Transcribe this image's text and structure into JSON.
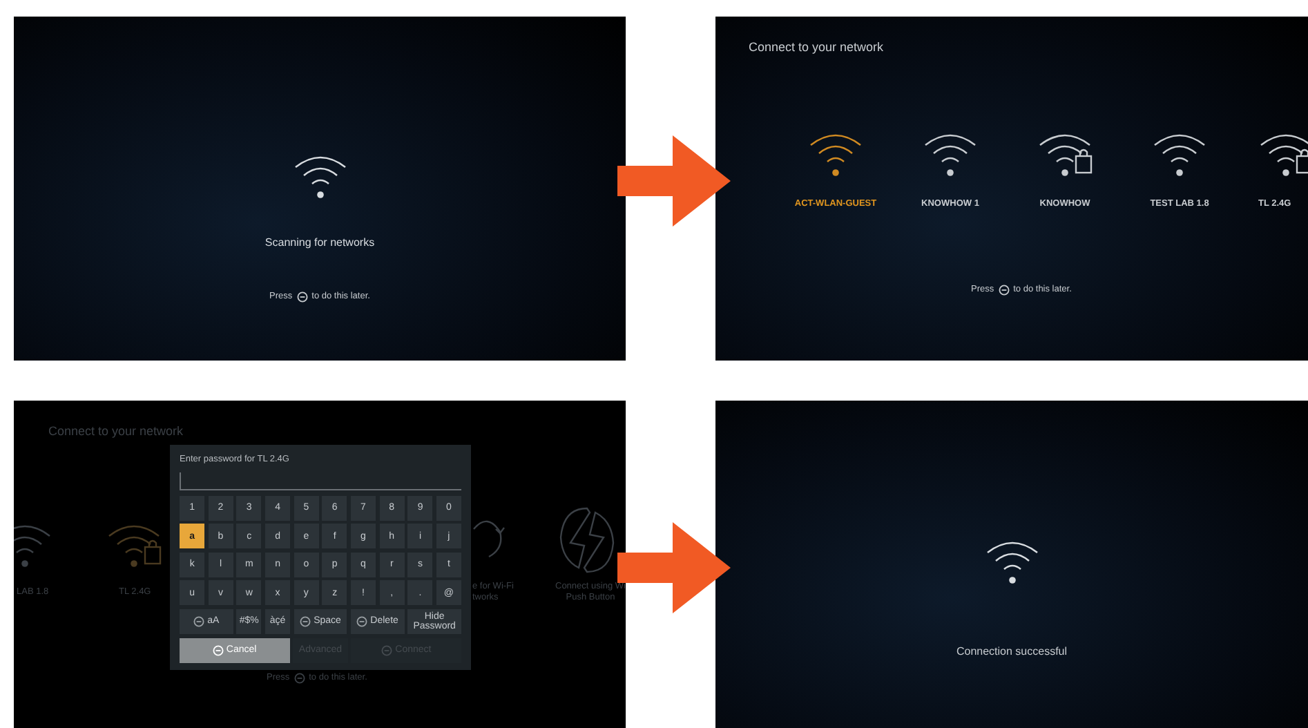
{
  "screens": [
    {
      "kind": "scanning",
      "message": "Scanning for networks",
      "hint_before": "Press",
      "hint_after": "to do this later."
    },
    {
      "kind": "network_list",
      "title": "Connect to your network",
      "networks": [
        {
          "name": "ACT-WLAN-GUEST",
          "selected": true,
          "locked": false
        },
        {
          "name": "KNOWHOW 1",
          "selected": false,
          "locked": false
        },
        {
          "name": "KNOWHOW",
          "selected": false,
          "locked": true
        },
        {
          "name": "TEST LAB 1.8",
          "selected": false,
          "locked": false
        },
        {
          "name": "TL 2.4G",
          "selected": false,
          "locked": true
        }
      ],
      "hint_before": "Press",
      "hint_after": "to do this later."
    },
    {
      "kind": "password",
      "background": {
        "title": "Connect to your network",
        "left_labels": [
          "LAB 1.8",
          "TL 2.4G"
        ],
        "rescan_label": [
          "e for Wi-Fi",
          "tworks"
        ],
        "wps_label": [
          "Connect using Wi",
          "Push Button"
        ],
        "hint_before": "Press",
        "hint_after": "to do this later."
      },
      "dialog": {
        "title": "Enter password for TL 2.4G",
        "keyboard": [
          {
            "keys": [
              {
                "label": "1",
                "kind": "char",
                "selected": false
              },
              {
                "label": "2",
                "kind": "char",
                "selected": false
              },
              {
                "label": "3",
                "kind": "char",
                "selected": false
              },
              {
                "label": "4",
                "kind": "char",
                "selected": false
              },
              {
                "label": "5",
                "kind": "char",
                "selected": false
              },
              {
                "label": "6",
                "kind": "char",
                "selected": false
              },
              {
                "label": "7",
                "kind": "char",
                "selected": false
              },
              {
                "label": "8",
                "kind": "char",
                "selected": false
              },
              {
                "label": "9",
                "kind": "char",
                "selected": false
              },
              {
                "label": "0",
                "kind": "char",
                "selected": false
              }
            ]
          },
          {
            "keys": [
              {
                "label": "a",
                "kind": "char",
                "selected": true
              },
              {
                "label": "b",
                "kind": "char",
                "selected": false
              },
              {
                "label": "c",
                "kind": "char",
                "selected": false
              },
              {
                "label": "d",
                "kind": "char",
                "selected": false
              },
              {
                "label": "e",
                "kind": "char",
                "selected": false
              },
              {
                "label": "f",
                "kind": "char",
                "selected": false
              },
              {
                "label": "g",
                "kind": "char",
                "selected": false
              },
              {
                "label": "h",
                "kind": "char",
                "selected": false
              },
              {
                "label": "i",
                "kind": "char",
                "selected": false
              },
              {
                "label": "j",
                "kind": "char",
                "selected": false
              }
            ]
          },
          {
            "keys": [
              {
                "label": "k",
                "kind": "char",
                "selected": false
              },
              {
                "label": "l",
                "kind": "char",
                "selected": false
              },
              {
                "label": "m",
                "kind": "char",
                "selected": false
              },
              {
                "label": "n",
                "kind": "char",
                "selected": false
              },
              {
                "label": "o",
                "kind": "char",
                "selected": false
              },
              {
                "label": "p",
                "kind": "char",
                "selected": false
              },
              {
                "label": "q",
                "kind": "char",
                "selected": false
              },
              {
                "label": "r",
                "kind": "char",
                "selected": false
              },
              {
                "label": "s",
                "kind": "char",
                "selected": false
              },
              {
                "label": "t",
                "kind": "char",
                "selected": false
              }
            ]
          },
          {
            "keys": [
              {
                "label": "u",
                "kind": "char",
                "selected": false
              },
              {
                "label": "v",
                "kind": "char",
                "selected": false
              },
              {
                "label": "w",
                "kind": "char",
                "selected": false
              },
              {
                "label": "x",
                "kind": "char",
                "selected": false
              },
              {
                "label": "y",
                "kind": "char",
                "selected": false
              },
              {
                "label": "z",
                "kind": "char",
                "selected": false
              },
              {
                "label": "!",
                "kind": "char",
                "selected": false
              },
              {
                "label": ",",
                "kind": "char",
                "selected": false
              },
              {
                "label": ".",
                "kind": "char",
                "selected": false
              },
              {
                "label": "@",
                "kind": "char",
                "selected": false
              }
            ]
          },
          {
            "keys": [
              {
                "label": "aA",
                "kind": "wide-icon",
                "selected": false
              },
              {
                "label": "#$%",
                "kind": "char",
                "selected": false
              },
              {
                "label": "àçé",
                "kind": "char",
                "selected": false
              },
              {
                "label": "Space",
                "kind": "wide-icon",
                "selected": false
              },
              {
                "label": "Delete",
                "kind": "wide-icon",
                "selected": false
              },
              {
                "label": "Hide Password",
                "kind": "wide",
                "selected": false
              }
            ]
          }
        ],
        "actions": [
          {
            "label": "Cancel",
            "selected": true,
            "disabled": false
          },
          {
            "label": "Advanced",
            "selected": false,
            "disabled": true
          },
          {
            "label": "Connect",
            "selected": false,
            "disabled": true
          }
        ]
      }
    },
    {
      "kind": "success",
      "message": "Connection successful"
    }
  ]
}
